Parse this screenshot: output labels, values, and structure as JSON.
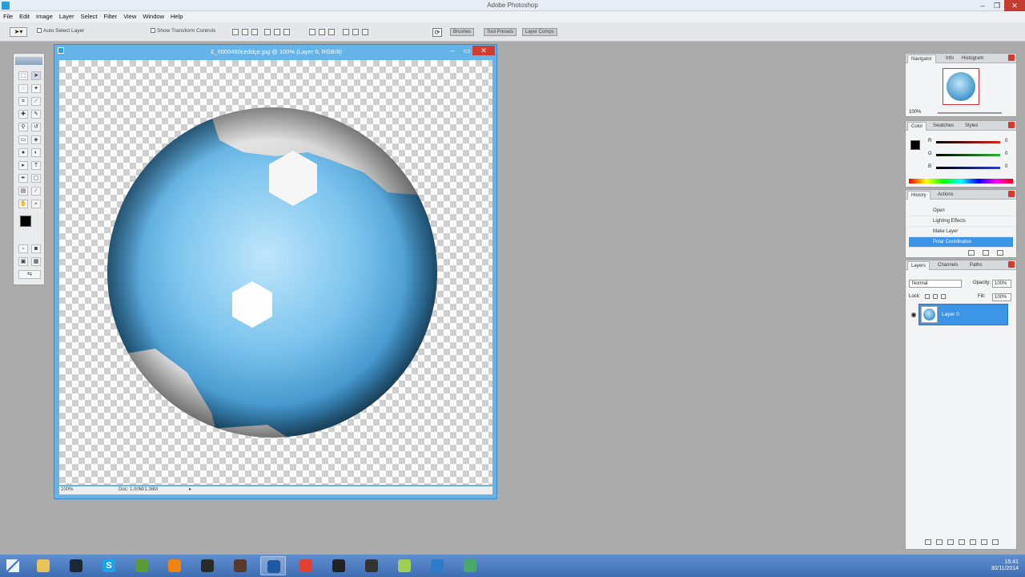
{
  "app": {
    "title": "Adobe Photoshop"
  },
  "menu": [
    "File",
    "Edit",
    "Image",
    "Layer",
    "Select",
    "Filter",
    "View",
    "Window",
    "Help"
  ],
  "options": {
    "auto_select_label": "Auto Select Layer",
    "show_transform_label": "Show Transform Controls",
    "tabs": [
      "Brushes",
      "Tool Presets",
      "Layer Comps"
    ]
  },
  "document": {
    "title": "£_0000460ceddçe.jpg @ 100% (Layer 0, RGB/8)",
    "zoom": "100%",
    "doc_info": "Doc: 1.00M/1.36M"
  },
  "navigator": {
    "tabs": [
      "Navigator",
      "Info",
      "Histogram"
    ],
    "zoom": "100%"
  },
  "color_panel": {
    "tabs": [
      "Color",
      "Swatches",
      "Styles"
    ],
    "channels": [
      {
        "label": "R",
        "value": "0",
        "color": "#d8261e"
      },
      {
        "label": "G",
        "value": "0",
        "color": "#2fb335"
      },
      {
        "label": "B",
        "value": "0",
        "color": "#2a3dc9"
      }
    ]
  },
  "history": {
    "tabs": [
      "History",
      "Actions"
    ],
    "items": [
      {
        "label": "Open",
        "selected": false
      },
      {
        "label": "Lighting Effects",
        "selected": false
      },
      {
        "label": "Make Layer",
        "selected": false
      },
      {
        "label": "Polar Coordinates",
        "selected": true
      }
    ]
  },
  "layers": {
    "tabs": [
      "Layers",
      "Channels",
      "Paths"
    ],
    "blend_mode": "Normal",
    "opacity_label": "Opacity:",
    "opacity": "100%",
    "lock_label": "Lock:",
    "fill_label": "Fill:",
    "fill": "100%",
    "rows": [
      {
        "name": "Layer 0"
      }
    ]
  },
  "taskbar": {
    "apps": [
      {
        "name": "file-explorer-icon",
        "glyph": "",
        "color": "#e7c35a",
        "active": false
      },
      {
        "name": "steam-icon",
        "glyph": "",
        "color": "#1b2838",
        "active": false
      },
      {
        "name": "skype-icon",
        "glyph": "S",
        "color": "#1ba5e8",
        "active": false
      },
      {
        "name": "minecraft-icon",
        "glyph": "",
        "color": "#5b9a3a",
        "active": false
      },
      {
        "name": "vlc-icon",
        "glyph": "",
        "color": "#f0820f",
        "active": false
      },
      {
        "name": "terminal-icon",
        "glyph": "",
        "color": "#2a2a2a",
        "active": false
      },
      {
        "name": "archive-icon",
        "glyph": "",
        "color": "#5a3a2e",
        "active": false
      },
      {
        "name": "photoshop-icon",
        "glyph": "",
        "color": "#1d5aa3",
        "active": true
      },
      {
        "name": "chrome-icon",
        "glyph": "",
        "color": "#e44134",
        "active": false
      },
      {
        "name": "obs-icon",
        "glyph": "",
        "color": "#222",
        "active": false
      },
      {
        "name": "paint-icon",
        "glyph": "",
        "color": "#333",
        "active": false
      },
      {
        "name": "recycle-bin-icon",
        "glyph": "",
        "color": "#9fcf57",
        "active": false
      },
      {
        "name": "network-icon",
        "glyph": "",
        "color": "#2d7bc9",
        "active": false
      },
      {
        "name": "monitor-icon",
        "glyph": "",
        "color": "#4aa86b",
        "active": false
      }
    ],
    "time": "15:41",
    "date": "30/11/2014"
  }
}
